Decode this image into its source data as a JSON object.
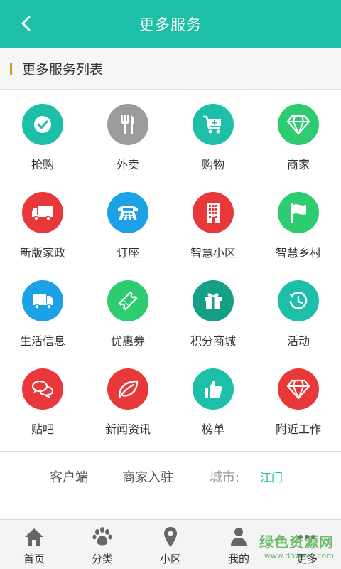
{
  "header": {
    "title": "更多服务",
    "back_icon": "chevron-left-icon"
  },
  "section": {
    "title": "更多服务列表",
    "accent": "#c8a022"
  },
  "services": [
    {
      "label": "抢购",
      "icon": "check-circle-icon",
      "color": "#1dbfa9"
    },
    {
      "label": "外卖",
      "icon": "fork-knife-icon",
      "color": "#9b9b9b"
    },
    {
      "label": "购物",
      "icon": "cart-icon",
      "color": "#1dbfa9"
    },
    {
      "label": "商家",
      "icon": "diamond-icon",
      "color": "#2ecc71"
    },
    {
      "label": "新版家政",
      "icon": "truck-icon",
      "color": "#e8383a"
    },
    {
      "label": "订座",
      "icon": "telephone-icon",
      "color": "#1aa1e6"
    },
    {
      "label": "智慧小区",
      "icon": "building-icon",
      "color": "#e8383a"
    },
    {
      "label": "智慧乡村",
      "icon": "flag-icon",
      "color": "#2ecc71"
    },
    {
      "label": "生活信息",
      "icon": "truck-icon",
      "color": "#1aa1e6"
    },
    {
      "label": "优惠券",
      "icon": "ticket-icon",
      "color": "#2ecc71"
    },
    {
      "label": "积分商城",
      "icon": "gift-icon",
      "color": "#14a085"
    },
    {
      "label": "活动",
      "icon": "history-icon",
      "color": "#1dbfa9"
    },
    {
      "label": "贴吧",
      "icon": "chat-bubbles-icon",
      "color": "#e8383a"
    },
    {
      "label": "新闻资讯",
      "icon": "leaf-icon",
      "color": "#e8383a"
    },
    {
      "label": "榜单",
      "icon": "thumbs-up-icon",
      "color": "#1dbfa9"
    },
    {
      "label": "附近工作",
      "icon": "diamond-icon",
      "color": "#e8383a"
    }
  ],
  "footer": {
    "client": "客户端",
    "merchant_join": "商家入驻",
    "city_label": "城市:",
    "city_value": "江门"
  },
  "tabs": [
    {
      "label": "首页",
      "icon": "home-icon"
    },
    {
      "label": "分类",
      "icon": "paw-icon"
    },
    {
      "label": "小区",
      "icon": "location-pin-icon"
    },
    {
      "label": "我的",
      "icon": "user-icon"
    },
    {
      "label": "更多",
      "icon": "more-dots-icon"
    }
  ],
  "watermark": {
    "main": "绿色资源网",
    "sub": "www.downcc.com"
  },
  "colors": {
    "primary": "#1dbfa9",
    "text": "#333333"
  }
}
